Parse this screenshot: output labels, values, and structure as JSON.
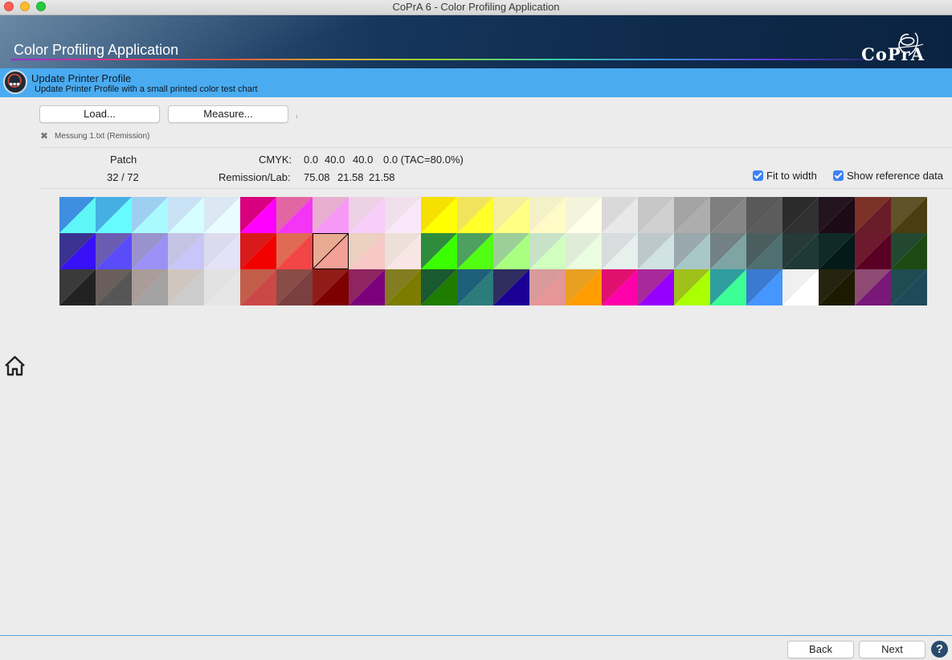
{
  "window": {
    "title": "CoPrA 6 - Color Profiling Application"
  },
  "banner": {
    "app_title": "Color Profiling Application",
    "logo_text": "CoPrA"
  },
  "step": {
    "title": "Update Printer Profile",
    "subtitle": "Update Printer Profile with a small printed color test chart",
    "icon": "gauge-icon"
  },
  "toolbar": {
    "load_label": "Load...",
    "measure_label": "Measure..."
  },
  "file": {
    "remove_icon": "close-icon",
    "label": "Messung 1.txt (Remission)"
  },
  "info": {
    "patch_label": "Patch",
    "patch_value": "32 / 72",
    "cmyk_label": "CMYK:",
    "cmyk_c": "0.0",
    "cmyk_m": "40.0",
    "cmyk_y": "40.0",
    "cmyk_k_tac": "0.0 (TAC=80.0%)",
    "lab_label": "Remission/Lab:",
    "lab_l": "75.08",
    "lab_a": "21.58",
    "lab_b": "21.58"
  },
  "options": {
    "fit_to_width": {
      "label": "Fit to width",
      "checked": true
    },
    "show_reference": {
      "label": "Show reference data",
      "checked": true
    }
  },
  "chart": {
    "rows": 3,
    "cols": 24,
    "selected_patch": 32,
    "patches": [
      [
        "#3e8fe0",
        "#5ef7f7"
      ],
      [
        "#45aee3",
        "#66fbff"
      ],
      [
        "#9ecff1",
        "#a8faff"
      ],
      [
        "#c9e2f5",
        "#d4feff"
      ],
      [
        "#dbe8f3",
        "#e9fdff"
      ],
      [
        "#d8007e",
        "#ff00ff"
      ],
      [
        "#e266a2",
        "#f535f5"
      ],
      [
        "#e8aed0",
        "#f798f7"
      ],
      [
        "#ecd0e4",
        "#f8cdf8"
      ],
      [
        "#f0e0ec",
        "#fbe7fb"
      ],
      [
        "#f4e100",
        "#ffff00"
      ],
      [
        "#f2e35c",
        "#ffff2a"
      ],
      [
        "#f4ee9e",
        "#ffff85"
      ],
      [
        "#f4f0c8",
        "#fffbc6"
      ],
      [
        "#f4f3dc",
        "#fffee8"
      ],
      [
        "#d9d9d9",
        "#e8e8e8"
      ],
      [
        "#c6c6c6",
        "#d0d0d0"
      ],
      [
        "#a4a4a4",
        "#adadad"
      ],
      [
        "#7e7e7e",
        "#868686"
      ],
      [
        "#595959",
        "#5c5c5c"
      ],
      [
        "#2b2b2b",
        "#303030"
      ],
      [
        "#231420",
        "#1c0a16"
      ],
      [
        "#7d3228",
        "#6a1c28"
      ],
      [
        "#5e5228",
        "#4a3e10"
      ],
      [
        "#3a3490",
        "#3810f8"
      ],
      [
        "#6a5cb0",
        "#5a4cf8"
      ],
      [
        "#9a92cc",
        "#9a90f6"
      ],
      [
        "#c6c4e4",
        "#c8c6f8"
      ],
      [
        "#dcdbee",
        "#e3e2f8"
      ],
      [
        "#d81a1a",
        "#f20000"
      ],
      [
        "#e06a52",
        "#f24545"
      ],
      [
        "#e9aa92",
        "#f3a098"
      ],
      [
        "#ecd0c0",
        "#f7c8c6"
      ],
      [
        "#ece0d8",
        "#f8e6e4"
      ],
      [
        "#2e8c3c",
        "#3aff00"
      ],
      [
        "#4ea060",
        "#52ff12"
      ],
      [
        "#9ccf98",
        "#a8ff80"
      ],
      [
        "#c8e2c8",
        "#d0ffc0"
      ],
      [
        "#e0ecd8",
        "#eaffe0"
      ],
      [
        "#d8dcdc",
        "#e8f0ee"
      ],
      [
        "#bcc8cc",
        "#d0e2e2"
      ],
      [
        "#98a8ac",
        "#a8c8c8"
      ],
      [
        "#728284",
        "#7ea4a4"
      ],
      [
        "#4a5e60",
        "#4e7070"
      ],
      [
        "#283a38",
        "#1f3a36"
      ],
      [
        "#102a28",
        "#041a18"
      ],
      [
        "#6e1a2e",
        "#5a0024"
      ],
      [
        "#224830",
        "#1c4a12"
      ],
      [
        "#3a3a3a",
        "#222222"
      ],
      [
        "#6a5e5c",
        "#565656"
      ],
      [
        "#aa9c98",
        "#a2a2a2"
      ],
      [
        "#d0c6c0",
        "#cccccc"
      ],
      [
        "#e2e2e2",
        "#e6e6e6"
      ],
      [
        "#c25e4a",
        "#cc4848"
      ],
      [
        "#8a4c46",
        "#7a4040"
      ],
      [
        "#901c18",
        "#7e0000"
      ],
      [
        "#8e2460",
        "#7c007c"
      ],
      [
        "#847c20",
        "#7c7c00"
      ],
      [
        "#1a5a30",
        "#1e7c00"
      ],
      [
        "#1e607a",
        "#2c7c7c"
      ],
      [
        "#2e2e60",
        "#1c0096"
      ],
      [
        "#d89a9a",
        "#e69696"
      ],
      [
        "#e9a020",
        "#ff9c00"
      ],
      [
        "#e0106e",
        "#ff00aa"
      ],
      [
        "#a82a9a",
        "#9600ff"
      ],
      [
        "#a0c01a",
        "#aaff00"
      ],
      [
        "#2e9ea0",
        "#3cff96"
      ],
      [
        "#3a7ad0",
        "#4696ff"
      ],
      [
        "#f0f0f0",
        "#ffffff"
      ],
      [
        "#262410",
        "#1c1a00"
      ],
      [
        "#8e4a72",
        "#781878"
      ],
      [
        "#1e4c50",
        "#1e4a5a"
      ]
    ]
  }
}
